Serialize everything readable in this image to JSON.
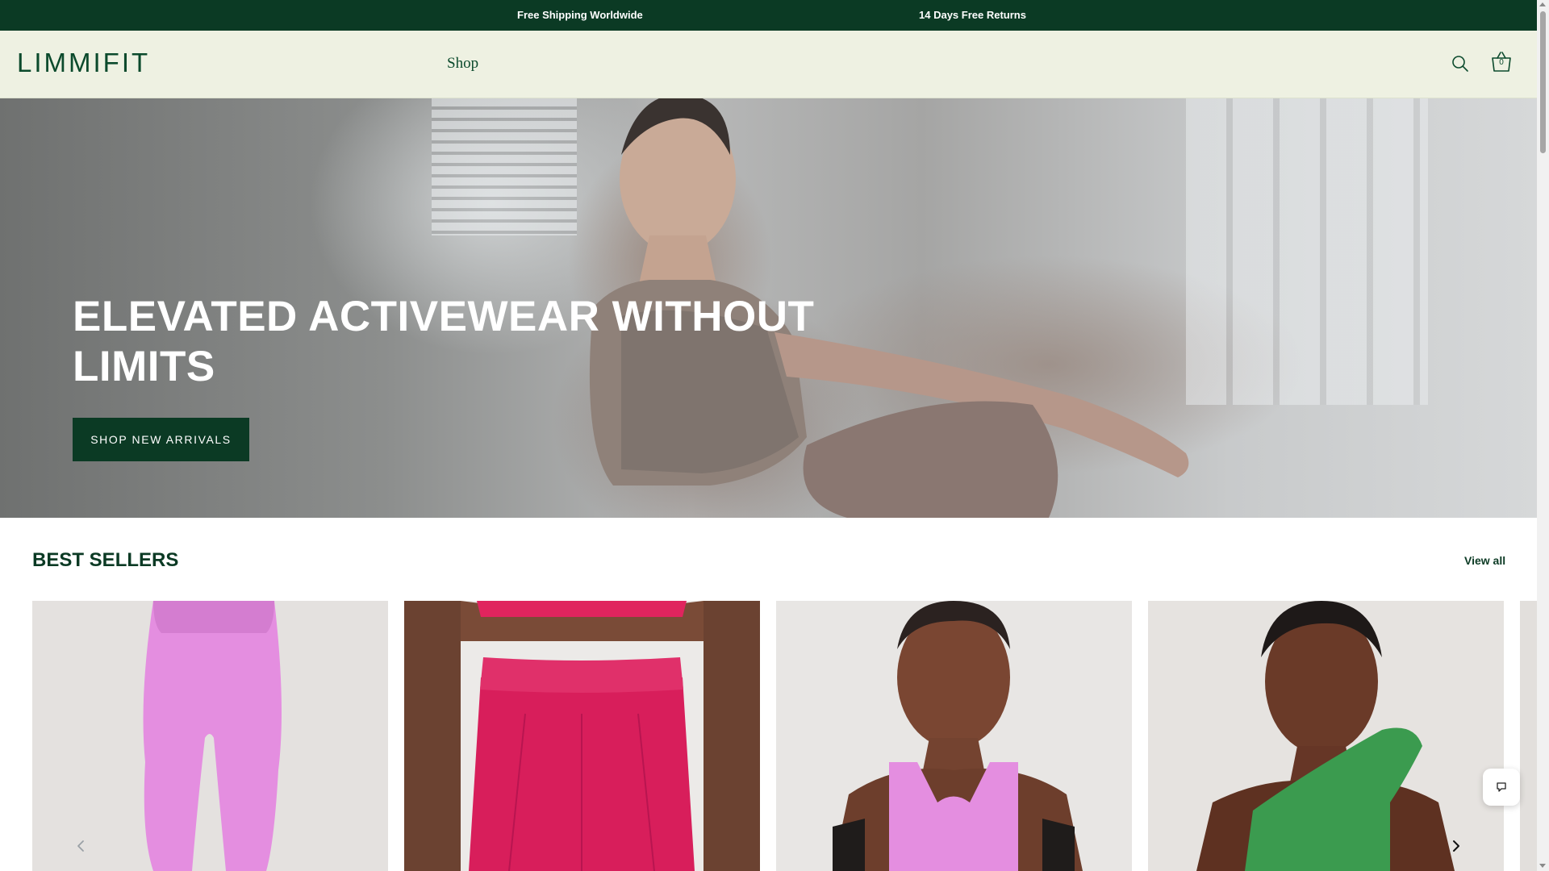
{
  "announcement": {
    "left": "Free Shipping Worldwide",
    "right": "14 Days Free Returns"
  },
  "header": {
    "logo": "LIMMIFIT",
    "nav_shop": "Shop",
    "search_icon": "search-icon",
    "cart_icon": "cart-icon",
    "cart_count": "0"
  },
  "hero": {
    "title": "ELEVATED ACTIVEWEAR WITHOUT LIMITS",
    "button_label": "SHOP NEW ARRIVALS"
  },
  "best_sellers": {
    "title": "BEST SELLERS",
    "view_all": "View all",
    "products": [
      {
        "image": "pink-scalloped-leggings"
      },
      {
        "image": "pink-pleated-skirt"
      },
      {
        "image": "pink-scalloped-sports-bra"
      },
      {
        "image": "green-one-shoulder-scalloped-top"
      }
    ],
    "prev_icon": "chevron-left-icon",
    "next_icon": "chevron-right-icon"
  },
  "chat": {
    "icon": "chat-icon"
  },
  "colors": {
    "brand_green": "#0b3a24",
    "header_bg": "#eef1e2",
    "logo_green": "#0b4a2c",
    "pink": "#e48ee0",
    "hot_pink": "#d81e5b",
    "green_top": "#3b9b4f"
  }
}
